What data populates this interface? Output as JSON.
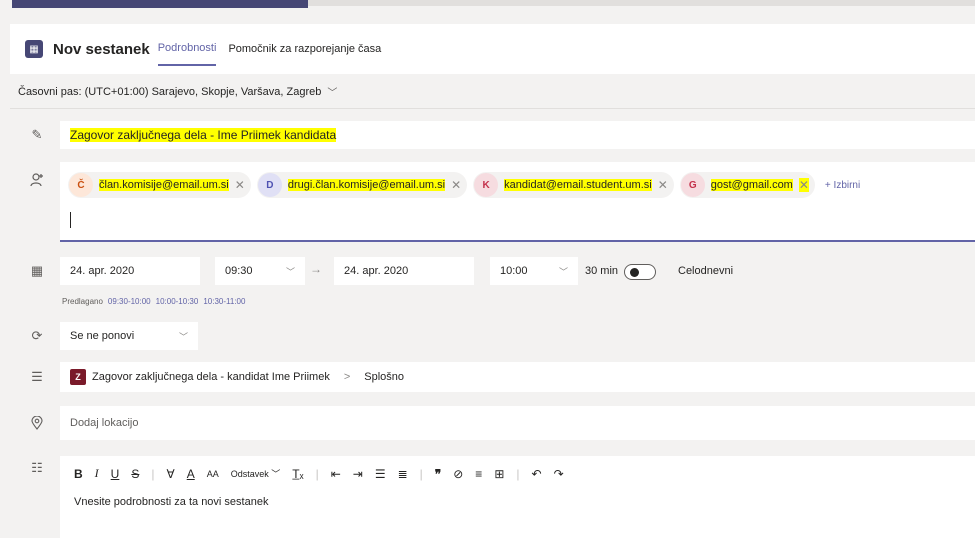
{
  "header": {
    "title": "Nov sestanek",
    "tabs": [
      {
        "label": "Podrobnosti",
        "active": true
      },
      {
        "label": "Pomočnik za razporejanje časa",
        "active": false
      }
    ]
  },
  "timezone": "Časovni pas: (UTC+01:00) Sarajevo, Skopje, Varšava, Zagreb",
  "meeting": {
    "title": "Zagovor zaključnega dela - Ime Priimek kandidata"
  },
  "attendees": [
    {
      "initial": "Č",
      "email": "član.komisije@email.um.si",
      "avatar_bg": "#fde7d9",
      "avatar_fg": "#ca5010"
    },
    {
      "initial": "D",
      "email": "drugi.član.komisije@email.um.si",
      "avatar_bg": "#e0e0f5",
      "avatar_fg": "#4f52b2"
    },
    {
      "initial": "K",
      "email": "kandidat@email.student.um.si",
      "avatar_bg": "#f6dce0",
      "avatar_fg": "#c4314b"
    },
    {
      "initial": "G",
      "email": "gost@gmail.com",
      "avatar_bg": "#f6dce0",
      "avatar_fg": "#c4314b"
    }
  ],
  "add_optional_label": "+ Izbirni",
  "datetime": {
    "start_date": "24. apr. 2020",
    "start_time": "09:30",
    "end_date": "24. apr. 2020",
    "end_time": "10:00",
    "duration": "30 min",
    "all_day_label": "Celodnevni",
    "all_day": false,
    "suggested_label": "Predlagano",
    "suggested_slots": [
      "09:30-10:00",
      "10:00-10:30",
      "10:30-11:00"
    ]
  },
  "recurrence": "Se ne ponovi",
  "channel": {
    "badge": "Z",
    "team": "Zagovor zaključnega dela - kandidat Ime Priimek",
    "separator": ">",
    "name": "Splošno"
  },
  "location_placeholder": "Dodaj lokacijo",
  "editor": {
    "paragraph_label": "Odstavek",
    "placeholder": "Vnesite podrobnosti za ta novi sestanek"
  },
  "colors": {
    "accent": "#6264a7",
    "highlight": "#ffff00"
  }
}
